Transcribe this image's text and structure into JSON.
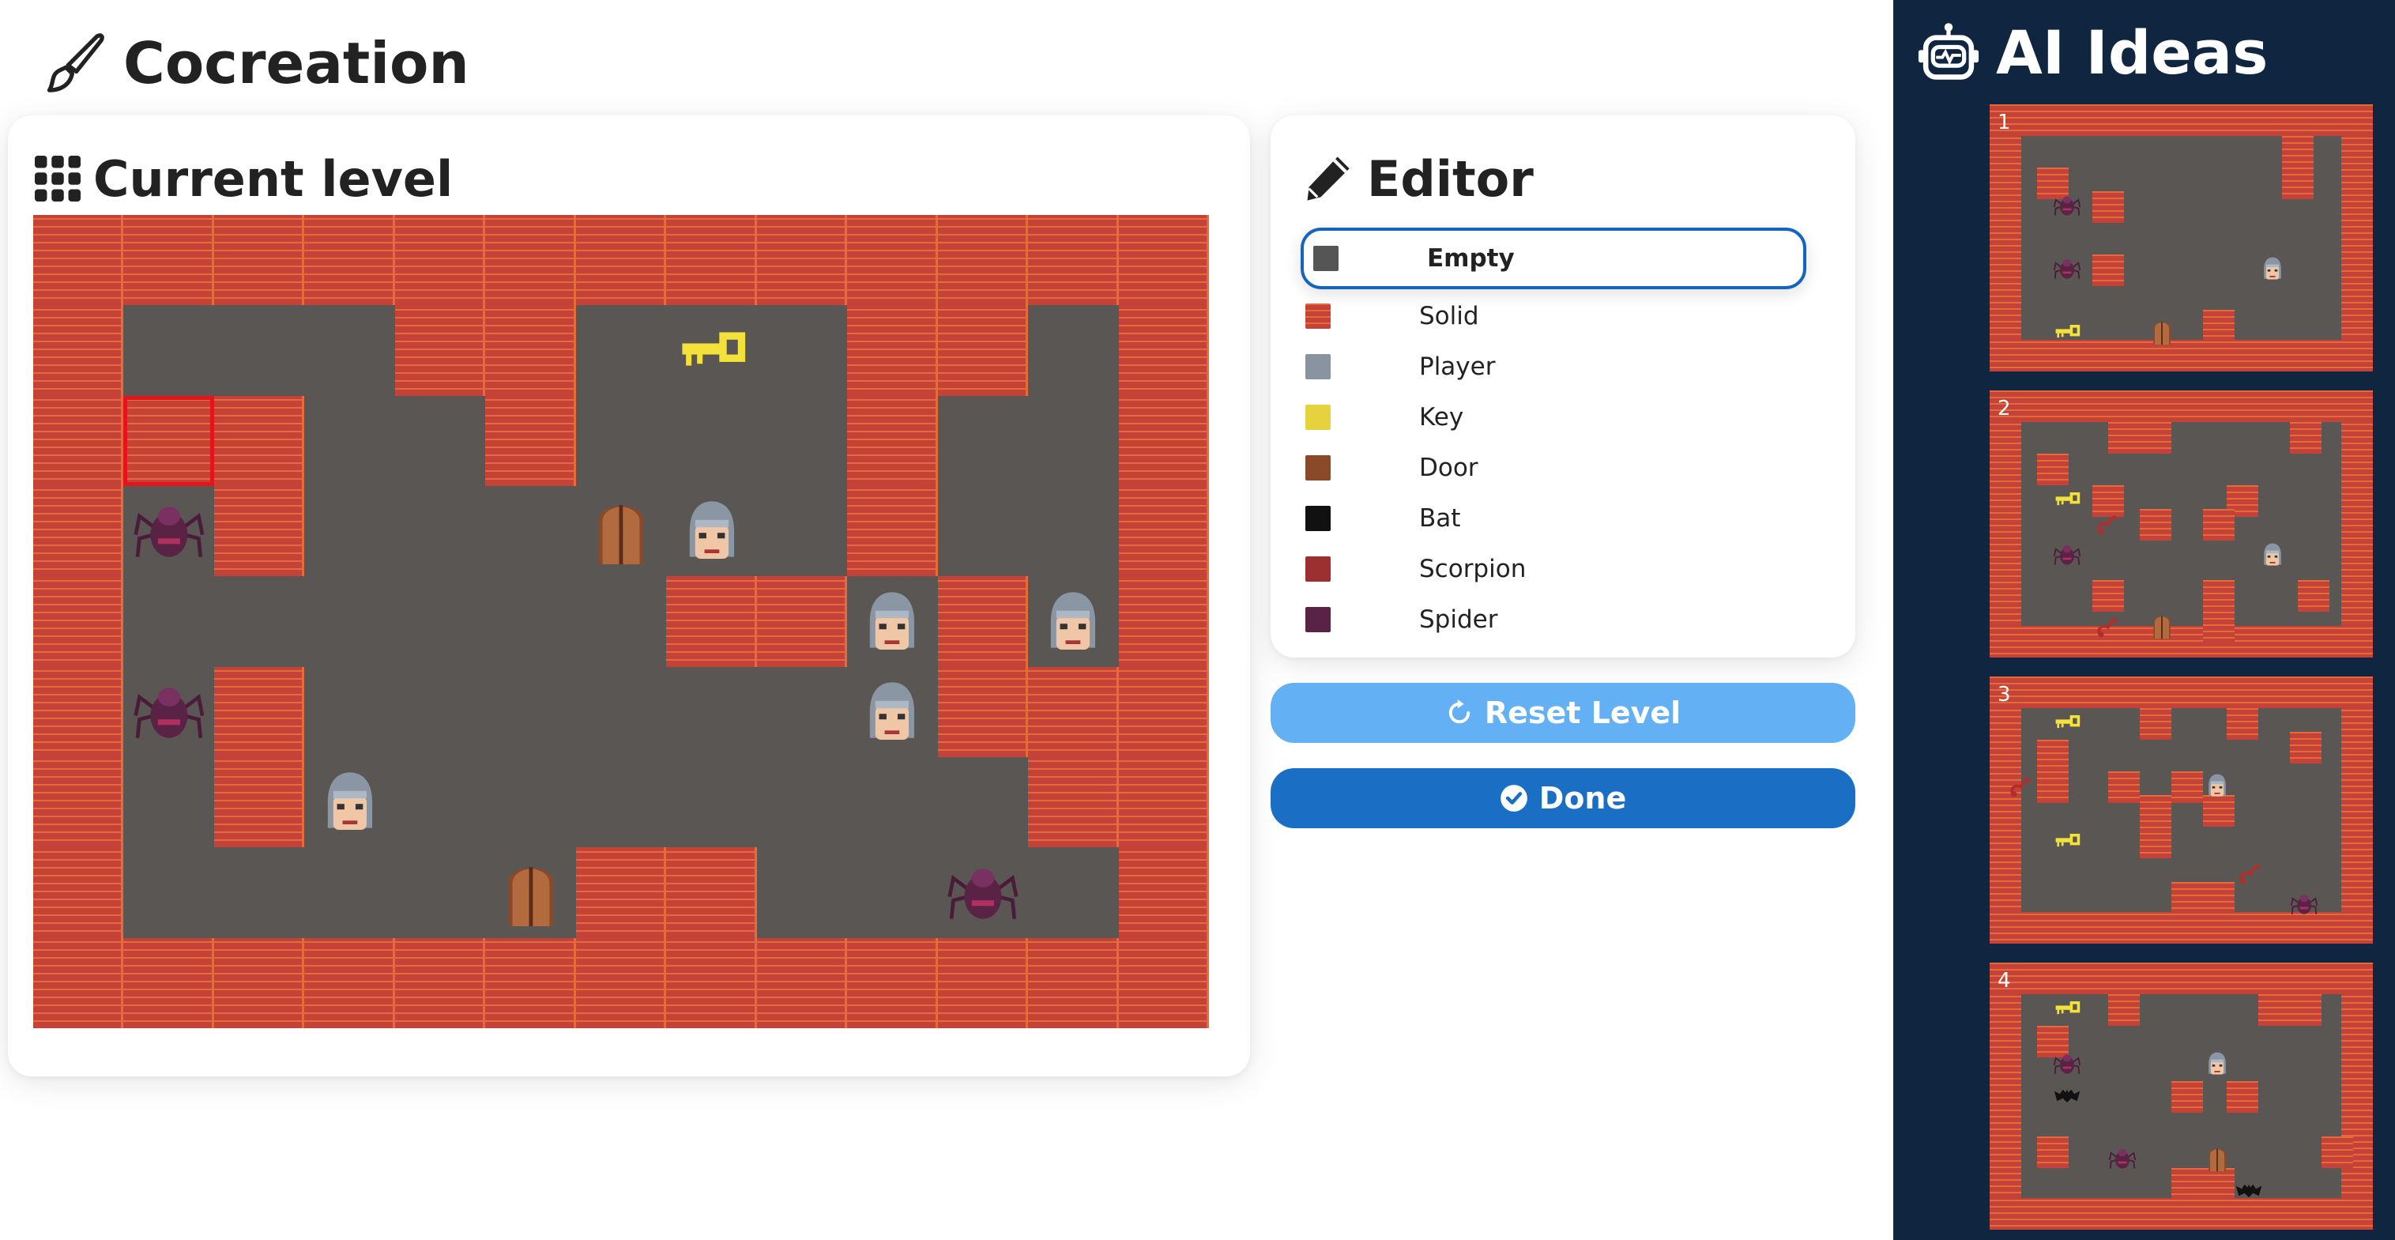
{
  "app": {
    "title": "Cocreation"
  },
  "level_panel": {
    "title": "Current level"
  },
  "editor": {
    "title": "Editor",
    "tiles": [
      {
        "label": "Empty",
        "selected": true,
        "color": "#555555"
      },
      {
        "label": "Solid",
        "selected": false,
        "color": "#c44237"
      },
      {
        "label": "Player",
        "selected": false,
        "color": "#8a94a0"
      },
      {
        "label": "Key",
        "selected": false,
        "color": "#e6d23c"
      },
      {
        "label": "Door",
        "selected": false,
        "color": "#8a4a2a"
      },
      {
        "label": "Bat",
        "selected": false,
        "color": "#111111"
      },
      {
        "label": "Scorpion",
        "selected": false,
        "color": "#9c2f2f"
      },
      {
        "label": "Spider",
        "selected": false,
        "color": "#5a2346"
      }
    ]
  },
  "buttons": {
    "reset": "Reset Level",
    "done": "Done"
  },
  "sidebar": {
    "title": "AI Ideas",
    "ideas": [
      {
        "number": "1"
      },
      {
        "number": "2"
      },
      {
        "number": "3"
      },
      {
        "number": "4"
      }
    ]
  },
  "colors": {
    "sidebar_bg": "#0f2540",
    "accent": "#1a6fc4",
    "accent_light": "#64b0f4",
    "selection": "#e3141b"
  },
  "level": {
    "rows": [
      "#############",
      "#...##.k.##.#",
      "#S#..#...#..#",
      "#p#...dP.#..#",
      "#......##P#P#",
      "#p#......P###",
      "#.#P.......##",
      "#....d##..p.#",
      "#############"
    ],
    "selected_cell": {
      "row": 2,
      "col": 1
    }
  }
}
